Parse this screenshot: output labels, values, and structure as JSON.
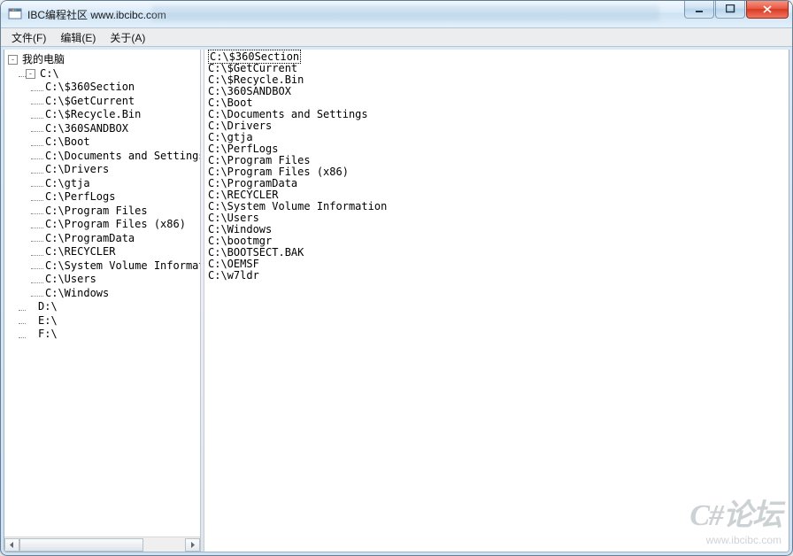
{
  "window": {
    "title": "IBC编程社区 www.ibcibc.com"
  },
  "menubar": [
    {
      "label": "文件(F)"
    },
    {
      "label": "编辑(E)"
    },
    {
      "label": "关于(A)"
    }
  ],
  "tree": {
    "root_label": "我的电脑",
    "drives": [
      {
        "label": "C:\\",
        "expanded": true,
        "children": [
          "C:\\$360Section",
          "C:\\$GetCurrent",
          "C:\\$Recycle.Bin",
          "C:\\360SANDBOX",
          "C:\\Boot",
          "C:\\Documents and Settings",
          "C:\\Drivers",
          "C:\\gtja",
          "C:\\PerfLogs",
          "C:\\Program Files",
          "C:\\Program Files (x86)",
          "C:\\ProgramData",
          "C:\\RECYCLER",
          "C:\\System Volume Informat",
          "C:\\Users",
          "C:\\Windows"
        ]
      },
      {
        "label": "D:\\"
      },
      {
        "label": "E:\\"
      },
      {
        "label": "F:\\"
      }
    ]
  },
  "listing": [
    "C:\\$360Section",
    "C:\\$GetCurrent",
    "C:\\$Recycle.Bin",
    "C:\\360SANDBOX",
    "C:\\Boot",
    "C:\\Documents and Settings",
    "C:\\Drivers",
    "C:\\gtja",
    "C:\\PerfLogs",
    "C:\\Program Files",
    "C:\\Program Files (x86)",
    "C:\\ProgramData",
    "C:\\RECYCLER",
    "C:\\System Volume Information",
    "C:\\Users",
    "C:\\Windows",
    "C:\\bootmgr",
    "C:\\BOOTSECT.BAK",
    "C:\\OEMSF",
    "C:\\w7ldr"
  ],
  "selected_index": 0,
  "watermark": {
    "line1": "C#论坛",
    "line2": "www.ibcibc.com"
  }
}
